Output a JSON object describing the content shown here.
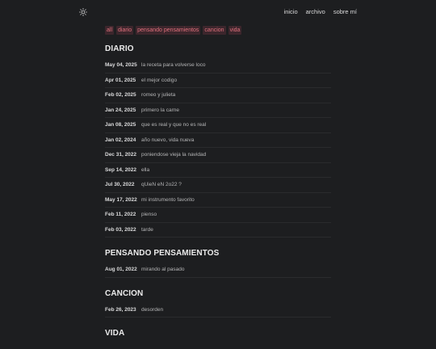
{
  "header": {
    "theme_icon": "sun-icon",
    "nav": [
      {
        "label": "inicio"
      },
      {
        "label": "archivo"
      },
      {
        "label": "sobre mí"
      }
    ]
  },
  "tags": [
    "all",
    "diario",
    "pensando pensamientos",
    "cancion",
    "vida"
  ],
  "sections": [
    {
      "heading": "DIARIO",
      "posts": [
        {
          "date": "May 04, 2025",
          "title": "la receta para volverse loco"
        },
        {
          "date": "Apr 01, 2025",
          "title": "el mejor codigo"
        },
        {
          "date": "Feb 02, 2025",
          "title": "romeo y julieta"
        },
        {
          "date": "Jan 24, 2025",
          "title": "primero la carne"
        },
        {
          "date": "Jan 08, 2025",
          "title": "que es real y que no es real"
        },
        {
          "date": "Jan 02, 2024",
          "title": "año nuevo, vida nueva"
        },
        {
          "date": "Dec 31, 2022",
          "title": "poniendose vieja la navidad"
        },
        {
          "date": "Sep 14, 2022",
          "title": "ella"
        },
        {
          "date": "Jul 30, 2022",
          "title": "qUieN eN 2o22 ?"
        },
        {
          "date": "May 17, 2022",
          "title": "mi instrumento favorito"
        },
        {
          "date": "Feb 11, 2022",
          "title": "pienso"
        },
        {
          "date": "Feb 03, 2022",
          "title": "tarde"
        }
      ]
    },
    {
      "heading": "PENSANDO PENSAMIENTOS",
      "posts": [
        {
          "date": "Aug 01, 2022",
          "title": "mirando al pasado"
        }
      ]
    },
    {
      "heading": "CANCION",
      "posts": [
        {
          "date": "Feb 26, 2023",
          "title": "desorden"
        }
      ]
    },
    {
      "heading": "VIDA",
      "posts": []
    }
  ]
}
